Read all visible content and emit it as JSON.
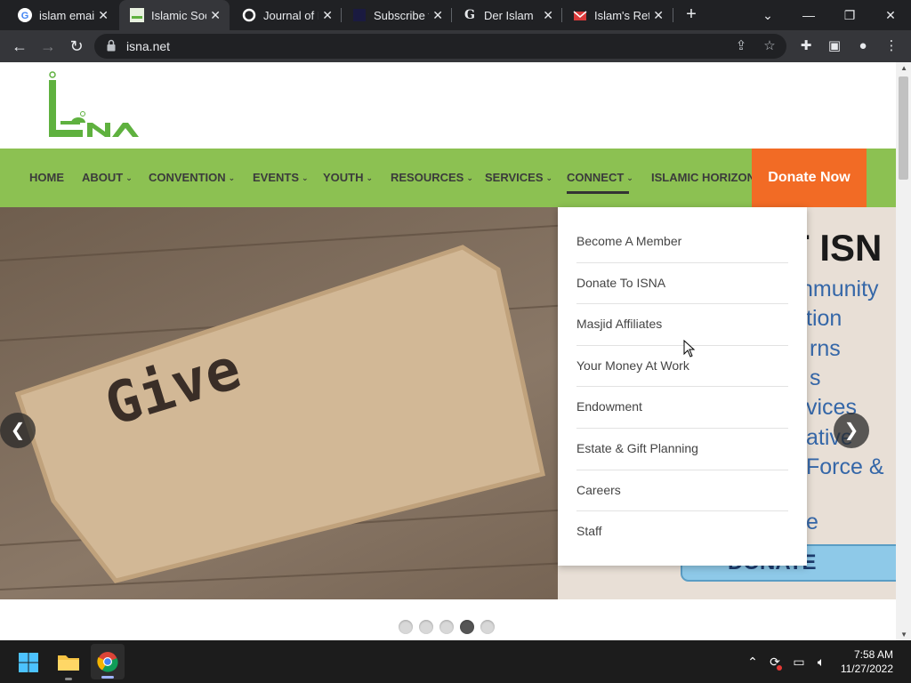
{
  "browser": {
    "tabs": [
      {
        "title": "islam email",
        "favicon": "google-g-icon",
        "active": false
      },
      {
        "title": "Islamic Soc",
        "favicon": "isna-favicon",
        "active": true
      },
      {
        "title": "Journal of I",
        "favicon": "circle-o-icon",
        "active": false
      },
      {
        "title": "Subscribe t",
        "favicon": "dark-square-icon",
        "active": false
      },
      {
        "title": "Der Islam",
        "favicon": "google-g-icon",
        "active": false
      },
      {
        "title": "Islam's Ret",
        "favicon": "red-envelope-icon",
        "active": false
      }
    ],
    "url": "isna.net"
  },
  "site": {
    "logo_text": "ISNA",
    "nav": [
      {
        "label": "HOME",
        "has_dropdown": false
      },
      {
        "label": "ABOUT",
        "has_dropdown": true
      },
      {
        "label": "CONVENTION",
        "has_dropdown": true
      },
      {
        "label": "EVENTS",
        "has_dropdown": true
      },
      {
        "label": "YOUTH",
        "has_dropdown": true
      },
      {
        "label": "RESOURCES",
        "has_dropdown": true
      },
      {
        "label": "SERVICES",
        "has_dropdown": true
      },
      {
        "label": "CONNECT",
        "has_dropdown": true
      },
      {
        "label": "ISLAMIC HORIZON",
        "has_dropdown": false
      }
    ],
    "donate_label": "Donate Now",
    "hero": {
      "word": "Give",
      "headline": "T ISN",
      "lines": [
        "nmunity",
        "tion",
        "rns",
        "s",
        "vices",
        "ative",
        "Force &",
        "e"
      ],
      "donate_label": "DONATE"
    },
    "connect_menu": [
      "Become A Member",
      "Donate To ISNA",
      "Masjid Affiliates",
      "Your Money At Work",
      "Endowment",
      "Estate & Gift Planning",
      "Careers",
      "Staff"
    ],
    "slider": {
      "count": 5,
      "active_index": 3
    }
  },
  "taskbar": {
    "time": "7:58 AM",
    "date": "11/27/2022"
  },
  "colors": {
    "nav_green": "#8cc152",
    "donate_orange": "#f26b25",
    "logo_green": "#5fb13f"
  }
}
